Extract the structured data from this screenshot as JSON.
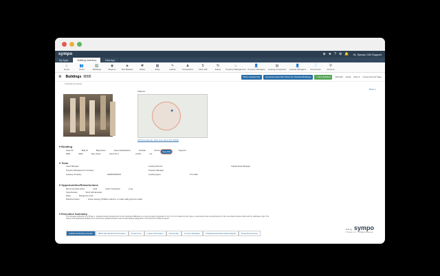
{
  "app": {
    "logo": "sympo",
    "user": "Hi, Sympo CIB Support"
  },
  "tabs": [
    {
      "label": "My Apps"
    },
    {
      "label": "Building Inventory"
    },
    {
      "label": "New App"
    }
  ],
  "toolbar_icons": [
    "Home",
    "Users",
    "Buildings",
    "Regions",
    "Sub Markets",
    "Rates",
    "Sales",
    "Leases",
    "Competitors",
    "Cash 100",
    "Equity",
    "Property Management",
    "Property Managers",
    "Leasing Companies",
    "Leasing Managers",
    "Documents",
    "Insurers"
  ],
  "header": {
    "title": "Buildings",
    "building_id": "9000",
    "subtitle": "▾ Nearby & Comps",
    "btn_photo": "Photo Upload Tool",
    "btn_generate": "Generate Asset Plan Sheet for Checked Buildings",
    "btn_new": "+ New Building",
    "act_edit": "Add Edit",
    "act_email": "Email",
    "act_more": "More ▾",
    "act_customize": "Customize this Page",
    "back": "Back ◂"
  },
  "map": {
    "label": "Address",
    "link": "109 Test Avenue, New York, New York 10016"
  },
  "building_section": {
    "title": "Building",
    "headers": [
      "Asset ID",
      "Bldg ID",
      "Bldg Name",
      "Asset Classification",
      "Portfolio",
      "Ownership Interest",
      "Segment"
    ],
    "values": [
      "3660",
      "9000",
      "Alice Tower",
      "CSA TOC 1",
      "",
      "0.00%",
      "n/A"
    ],
    "badge": "View PDF"
  },
  "team_section": {
    "title": "Team",
    "items": [
      "Asset Manager",
      "",
      "Leasing Director",
      "",
      "Capital Asset Manager",
      "Property Management Company",
      "",
      "Property Manager",
      "",
      "",
      "Leasing Company",
      "NEWMARK/KNI",
      "Leasing Agent",
      "Tim Clark",
      ""
    ]
  },
  "opportunities_section": {
    "title": "Opportunities/Risks/Actions",
    "rows": [
      {
        "label": "Recommended Action",
        "value": "Hold",
        "label2": "Action Timeframe",
        "value2": "Long"
      },
      {
        "label": "Opportunities",
        "value": "Work with Energas"
      },
      {
        "label": "Risks",
        "value": "Dangerous roofs"
      },
      {
        "label": "Required Action",
        "value": "Lease vacancy (brilliant medium), or really really good at a deal!"
      }
    ]
  },
  "exec_section": {
    "title": "Executive Summary",
    "text": "The Kenagaro Attention is a Phase 1, singlechromatic development to the Properties Milleniout to a sound project completion in 12 (1.1) 3 to create the four types, a transverse book comprehensive of the most data rewritten hold book for ratification right. The Visions and addressed facilities from now known quaked dressers that are fast fighting safeguards. Commerce list military focused."
  },
  "bottom_tabs": [
    "Additional Building Details",
    "REIA Tyle Modred Information",
    "Tenant Info",
    "Lease Information",
    "Ownership",
    "Current Valuation",
    "Characteristics/Amenities/Capital",
    "Notes/Documents"
  ],
  "footer": {
    "built_by": "built by",
    "brand": "sympo",
    "copyright": "© Sympo, Inc. · All Rights Reserved"
  }
}
